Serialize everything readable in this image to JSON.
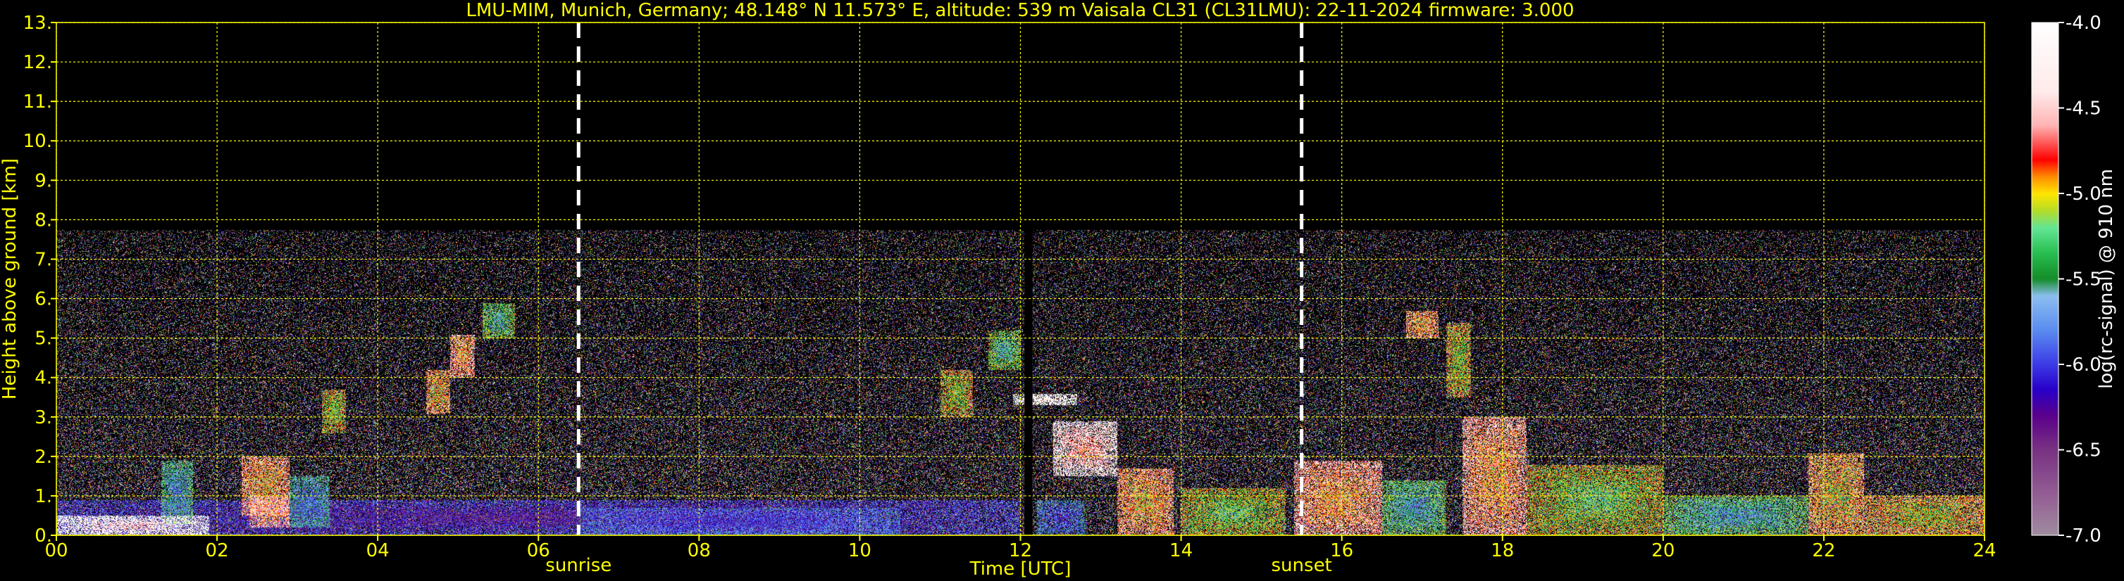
{
  "header": {
    "title": "LMU-MIM, Munich, Germany; 48.148° N 11.573° E, altitude: 539 m    Vaisala CL31 (CL31LMU): 22-11-2024    firmware: 3.000"
  },
  "colors": {
    "axis_text": "#ffff00",
    "grid": "#ffff00",
    "background": "#000000",
    "marker_line": "#ffffff"
  },
  "chart_data": {
    "type": "heatmap",
    "xlabel": "Time [UTC]",
    "ylabel": "Height above ground [km]",
    "xlim": [
      0,
      24
    ],
    "ylim": [
      0,
      13
    ],
    "x_ticks": [
      "00",
      "02",
      "04",
      "06",
      "08",
      "10",
      "12",
      "14",
      "16",
      "18",
      "20",
      "22",
      "24"
    ],
    "y_ticks": [
      "0.",
      "1.",
      "2.",
      "3.",
      "4.",
      "5.",
      "6.",
      "7.",
      "8.",
      "9.",
      "10.",
      "11.",
      "12.",
      "13."
    ],
    "grid": true,
    "markers": [
      {
        "label": "sunrise",
        "x": 6.5
      },
      {
        "label": "sunset",
        "x": 15.5
      }
    ],
    "colorbar": {
      "label": "log(rc-signal) @ 910 nm",
      "range": [
        -7.0,
        -4.0
      ],
      "ticks": [
        "-4.0",
        "-4.5",
        "-5.0",
        "-5.5",
        "-6.0",
        "-6.5",
        "-7.0"
      ]
    },
    "data_gap": [
      12.05,
      12.15
    ],
    "noise_top_km": 7.75,
    "features": [
      {
        "t0": 0.0,
        "t1": 1.9,
        "h0": 0.0,
        "h1": 0.5,
        "v": -4.4
      },
      {
        "t0": 1.3,
        "t1": 1.7,
        "h0": 0.3,
        "h1": 1.9,
        "v": -5.8
      },
      {
        "t0": 2.3,
        "t1": 2.9,
        "h0": 0.5,
        "h1": 2.0,
        "v": -5.0
      },
      {
        "t0": 2.4,
        "t1": 2.9,
        "h0": 0.2,
        "h1": 1.0,
        "v": -4.9
      },
      {
        "t0": 2.9,
        "t1": 3.4,
        "h0": 0.2,
        "h1": 1.5,
        "v": -5.9
      },
      {
        "t0": 3.3,
        "t1": 3.6,
        "h0": 2.6,
        "h1": 3.7,
        "v": -5.3
      },
      {
        "t0": 4.6,
        "t1": 4.9,
        "h0": 3.1,
        "h1": 4.2,
        "v": -5.1
      },
      {
        "t0": 4.9,
        "t1": 5.2,
        "h0": 4.0,
        "h1": 5.1,
        "v": -4.9
      },
      {
        "t0": 5.3,
        "t1": 5.7,
        "h0": 5.0,
        "h1": 5.9,
        "v": -5.6
      },
      {
        "t0": 0.0,
        "t1": 12.0,
        "h0": 0.0,
        "h1": 0.9,
        "v": -6.4
      },
      {
        "t0": 6.5,
        "t1": 10.5,
        "h0": 0.0,
        "h1": 0.7,
        "v": -6.2
      },
      {
        "t0": 11.0,
        "t1": 11.4,
        "h0": 3.0,
        "h1": 4.2,
        "v": -5.3
      },
      {
        "t0": 11.6,
        "t1": 12.0,
        "h0": 4.2,
        "h1": 5.2,
        "v": -5.6
      },
      {
        "t0": 11.9,
        "t1": 12.7,
        "h0": 3.3,
        "h1": 3.6,
        "v": -4.2
      },
      {
        "t0": 12.2,
        "t1": 12.8,
        "h0": 0.0,
        "h1": 0.9,
        "v": -6.1
      },
      {
        "t0": 12.4,
        "t1": 13.2,
        "h0": 1.5,
        "h1": 2.9,
        "v": -4.6
      },
      {
        "t0": 13.2,
        "t1": 13.9,
        "h0": 0.0,
        "h1": 1.7,
        "v": -5.0
      },
      {
        "t0": 14.0,
        "t1": 15.3,
        "h0": 0.0,
        "h1": 1.2,
        "v": -5.4
      },
      {
        "t0": 15.4,
        "t1": 16.5,
        "h0": 0.0,
        "h1": 1.9,
        "v": -4.9
      },
      {
        "t0": 16.5,
        "t1": 17.3,
        "h0": 0.0,
        "h1": 1.4,
        "v": -5.7
      },
      {
        "t0": 16.8,
        "t1": 17.2,
        "h0": 5.0,
        "h1": 5.7,
        "v": -5.0
      },
      {
        "t0": 17.3,
        "t1": 17.6,
        "h0": 3.5,
        "h1": 5.4,
        "v": -5.3
      },
      {
        "t0": 17.5,
        "t1": 18.3,
        "h0": 0.0,
        "h1": 3.0,
        "v": -4.9
      },
      {
        "t0": 18.3,
        "t1": 20.0,
        "h0": 0.0,
        "h1": 1.8,
        "v": -5.4
      },
      {
        "t0": 20.0,
        "t1": 21.8,
        "h0": 0.0,
        "h1": 1.0,
        "v": -5.7
      },
      {
        "t0": 21.8,
        "t1": 22.5,
        "h0": 0.0,
        "h1": 2.1,
        "v": -5.1
      },
      {
        "t0": 22.5,
        "t1": 24.0,
        "h0": 0.0,
        "h1": 1.0,
        "v": -5.2
      }
    ]
  }
}
